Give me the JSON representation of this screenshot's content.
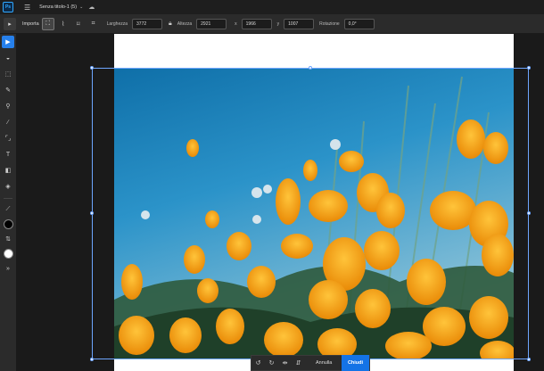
{
  "topbar": {
    "app_logo": "Ps",
    "document_title": "Senza titolo-1 (5)"
  },
  "options": {
    "import_label": "Importa",
    "width_label": "Larghezza",
    "width_value": "3772",
    "height_label": "Altezza",
    "height_value": "2921",
    "x_label": "x",
    "x_value": "1966",
    "y_label": "y",
    "y_value": "1007",
    "rotation_label": "Rotazione",
    "rotation_value": "0,0°"
  },
  "bottombar": {
    "cancel_label": "Annulla",
    "done_label": "Chiudi"
  },
  "colors": {
    "accent": "#1473e6",
    "foreground_swatch": "#000000",
    "background_swatch": "#ffffff"
  },
  "icons": [
    "hamburger-icon",
    "chevron-down-icon",
    "cloud-icon",
    "move-icon",
    "lock-icon",
    "undo-icon",
    "redo-icon",
    "flip-icon"
  ]
}
